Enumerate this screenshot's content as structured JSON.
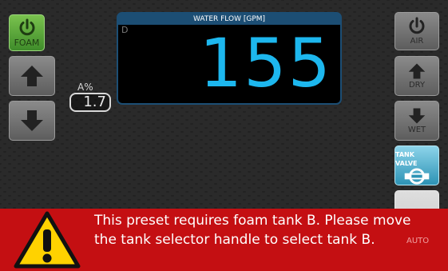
{
  "display": {
    "title": "WATER FLOW [GPM]",
    "tag": "D",
    "value": "155"
  },
  "concentration": {
    "unit": "A%",
    "value": "1.7"
  },
  "left_buttons": {
    "foam_label": "FOAM"
  },
  "right_buttons": {
    "air_label": "AIR",
    "dry_label": "DRY",
    "wet_label": "WET",
    "tank_valve_label": "TANK VALVE",
    "auto_label": "AUTO"
  },
  "banner": {
    "line1": "This preset requires foam tank B.  Please move",
    "line2": "the tank selector handle to select tank B."
  },
  "colors": {
    "accent": "#1db7ee",
    "foam_green": "#5aa83a",
    "alert_red": "#c40f12",
    "display_frame": "#1c4e74"
  },
  "icons": [
    "power-icon",
    "arrow-up-icon",
    "arrow-down-icon",
    "valve-icon",
    "warning-icon"
  ]
}
